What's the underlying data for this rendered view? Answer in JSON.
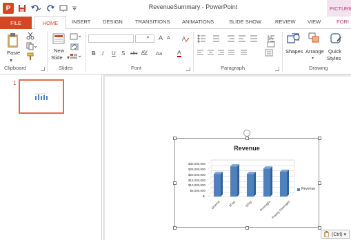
{
  "window": {
    "title": "RevenueSummary - PowerPoint",
    "app_icon": "P",
    "context_tab": "PICTURE"
  },
  "qat": {
    "save_icon": "save-icon",
    "undo_icon": "undo-icon",
    "redo_icon": "redo-icon",
    "customize_icon": "customize-icon"
  },
  "tabs": {
    "file": "FILE",
    "home": "HOME",
    "insert": "INSERT",
    "design": "DESIGN",
    "transitions": "TRANSITIONS",
    "animations": "ANIMATIONS",
    "slide_show": "SLIDE SHOW",
    "review": "REVIEW",
    "view": "VIEW",
    "format": "FORI"
  },
  "ribbon": {
    "clipboard": {
      "paste_label": "Paste",
      "group": "Clipboard"
    },
    "slides": {
      "new_label": "New",
      "slide_label": "Slide",
      "group": "Slides"
    },
    "font": {
      "bold": "B",
      "italic": "I",
      "underline": "U",
      "strike": "S",
      "abc": "abc",
      "av": "AV",
      "aa": "Aa",
      "grow": "A",
      "shrink": "A",
      "color": "A",
      "group": "Font"
    },
    "paragraph": {
      "group": "Paragraph"
    },
    "drawing": {
      "shapes_label": "Shapes",
      "arrange_label": "Arrange",
      "quick_label": "Quick",
      "styles_label": "Styles",
      "group": "Drawing"
    }
  },
  "thumbnail": {
    "number": "1"
  },
  "chart_data": {
    "type": "bar",
    "title": "Revenue",
    "categories": [
      "Ground",
      "3Day",
      "2Day",
      "Overnight",
      "Priority Overnight"
    ],
    "series": [
      {
        "name": "Revenue",
        "values": [
          21000000,
          28000000,
          21000000,
          26000000,
          23000000
        ],
        "color": "#4f81bd"
      }
    ],
    "ylim": [
      0,
      30000000
    ],
    "y_ticks": [
      "$30,000,000",
      "$25,000,000",
      "$20,000,000",
      "$15,000,000",
      "$10,000,000",
      "$5,000,000",
      "$-"
    ],
    "legend": "right"
  },
  "paste_options": {
    "label": "(Ctrl) ▾"
  }
}
